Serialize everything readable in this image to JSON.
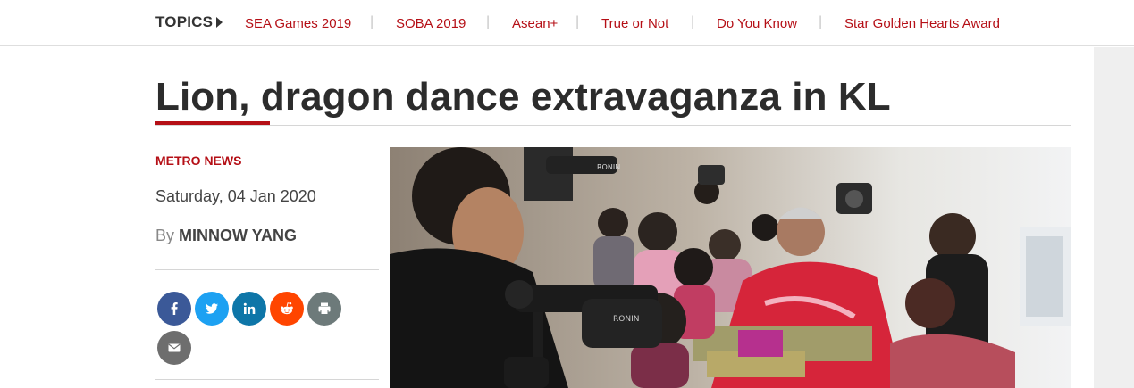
{
  "topics": {
    "label": "TOPICS",
    "items": [
      {
        "label": "SEA Games 2019"
      },
      {
        "label": "SOBA 2019"
      },
      {
        "label": "Asean+"
      },
      {
        "label": "True or Not"
      },
      {
        "label": "Do You Know"
      },
      {
        "label": "Star Golden Hearts Award"
      }
    ],
    "separator": "|"
  },
  "article": {
    "headline": "Lion, dragon dance extravaganza in KL",
    "category": "METRO NEWS",
    "date": "Saturday, 04 Jan 2020",
    "by_label": "By",
    "author": "MINNOW YANG"
  },
  "share": {
    "buttons": [
      {
        "network": "facebook",
        "icon": "facebook-icon",
        "color": "#3b5998"
      },
      {
        "network": "twitter",
        "icon": "twitter-icon",
        "color": "#1da1f2"
      },
      {
        "network": "linkedin",
        "icon": "linkedin-icon",
        "color": "#0e76a8"
      },
      {
        "network": "reddit",
        "icon": "reddit-icon",
        "color": "#ff4500"
      },
      {
        "network": "print",
        "icon": "print-icon",
        "color": "#6d7a7a"
      },
      {
        "network": "email",
        "icon": "email-icon",
        "color": "#6e6e6e"
      }
    ]
  },
  "image": {
    "icon": "photo-image",
    "overlay_text": "RONIN"
  },
  "colors": {
    "accent": "#b50f16",
    "text": "#2c2c2c"
  }
}
